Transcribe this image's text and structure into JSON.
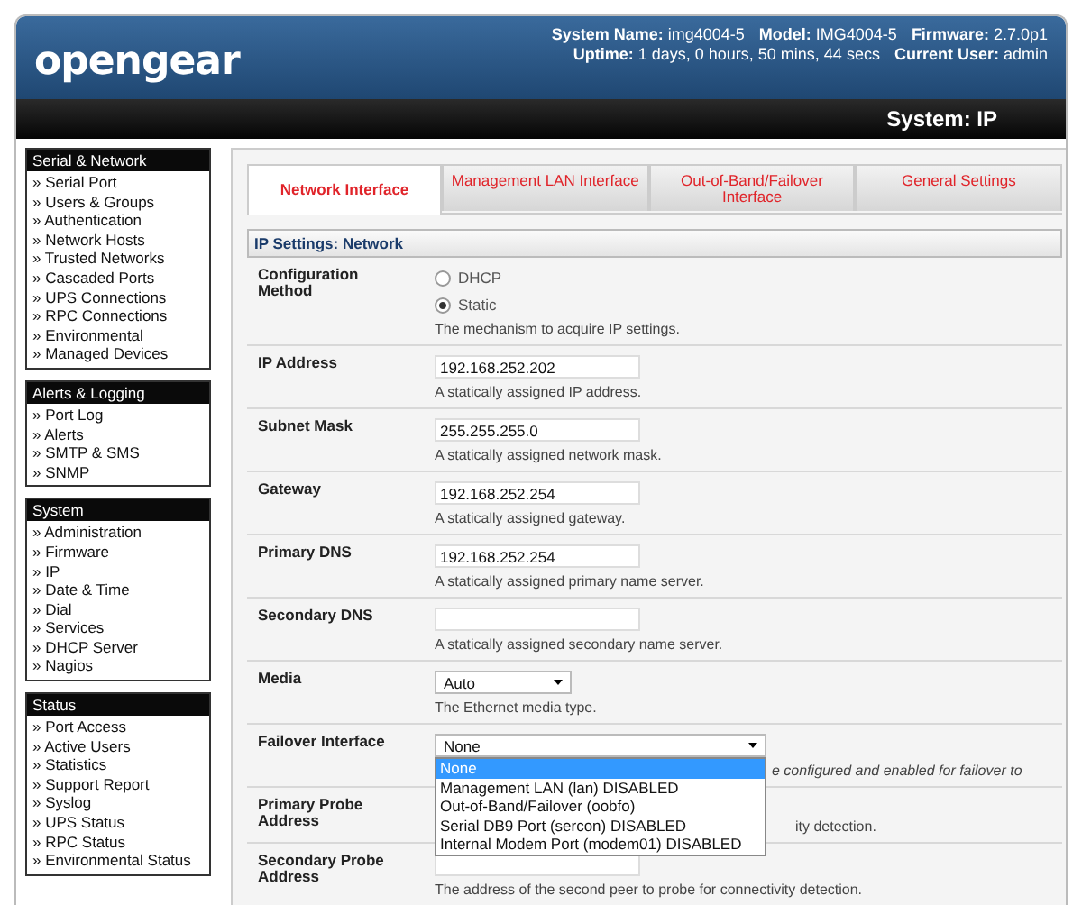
{
  "header": {
    "logo": "opengear",
    "info_lines": [
      [
        {
          "label": "System Name:",
          "value": "img4004-5"
        },
        {
          "label": "Model:",
          "value": "IMG4004-5"
        },
        {
          "label": "Firmware:",
          "value": "2.7.0p1"
        }
      ],
      [
        {
          "label": "Uptime:",
          "value": "1 days, 0 hours, 50 mins, 44 secs"
        },
        {
          "label": "Current User:",
          "value": "admin"
        }
      ]
    ],
    "page_title": "System: IP"
  },
  "sidebar": [
    {
      "title": "Serial & Network",
      "items": [
        "» Serial Port",
        "» Users & Groups",
        "» Authentication",
        "» Network Hosts",
        "» Trusted Networks",
        "» Cascaded Ports",
        "» UPS Connections",
        "» RPC Connections",
        "» Environmental",
        "» Managed Devices"
      ]
    },
    {
      "title": "Alerts & Logging",
      "items": [
        "» Port Log",
        "» Alerts",
        "» SMTP & SMS",
        "» SNMP"
      ]
    },
    {
      "title": "System",
      "items": [
        "» Administration",
        "» Firmware",
        "» IP",
        "» Date & Time",
        "» Dial",
        "» Services",
        "» DHCP Server",
        "» Nagios"
      ]
    },
    {
      "title": "Status",
      "items": [
        "» Port Access",
        "» Active Users",
        "» Statistics",
        "» Support Report",
        "» Syslog",
        "» UPS Status",
        "» RPC Status",
        "» Environmental Status"
      ]
    }
  ],
  "tabs": [
    {
      "label": "Network Interface",
      "selected": true
    },
    {
      "label": "Management LAN Interface",
      "selected": false
    },
    {
      "label": "Out-of-Band/Failover Interface",
      "selected": false
    },
    {
      "label": "General Settings",
      "selected": false
    }
  ],
  "section_title": "IP Settings: Network",
  "rows": [
    {
      "label": "Configuration Method",
      "kind": "radio",
      "options": [
        {
          "label": "DHCP",
          "selected": false
        },
        {
          "label": "Static",
          "selected": true
        }
      ],
      "description": "The mechanism to acquire IP settings."
    },
    {
      "label": "IP Address",
      "kind": "text",
      "value": "192.168.252.202",
      "description": "A statically assigned IP address."
    },
    {
      "label": "Subnet Mask",
      "kind": "text",
      "value": "255.255.255.0",
      "description": "A statically assigned network mask."
    },
    {
      "label": "Gateway",
      "kind": "text",
      "value": "192.168.252.254",
      "description": "A statically assigned gateway."
    },
    {
      "label": "Primary DNS",
      "kind": "text",
      "value": "192.168.252.254",
      "description": "A statically assigned primary name server."
    },
    {
      "label": "Secondary DNS",
      "kind": "text",
      "description": "A statically assigned secondary name server."
    },
    {
      "label": "Media",
      "kind": "select",
      "value": "Auto",
      "description": "The Ethernet media type."
    },
    {
      "label": "Failover Interface",
      "kind": "select",
      "value": "None",
      "expanded": true,
      "options": [
        {
          "label": "None",
          "selected": true
        },
        {
          "label": "Management LAN (lan) DISABLED",
          "selected": false
        },
        {
          "label": "Out-of-Band/Failover (oobfo)",
          "selected": false
        },
        {
          "label": "Serial DB9 Port (sercon) DISABLED",
          "selected": false
        },
        {
          "label": "Internal Modem Port (modem01) DISABLED",
          "selected": false
        }
      ],
      "description": "e configured and enabled for failover to"
    },
    {
      "label": "Primary Probe Address",
      "kind": "hidden",
      "description": "ity detection."
    },
    {
      "label": "Secondary Probe Address",
      "kind": "text",
      "description": "The address of the second peer to probe for connectivity detection."
    }
  ]
}
